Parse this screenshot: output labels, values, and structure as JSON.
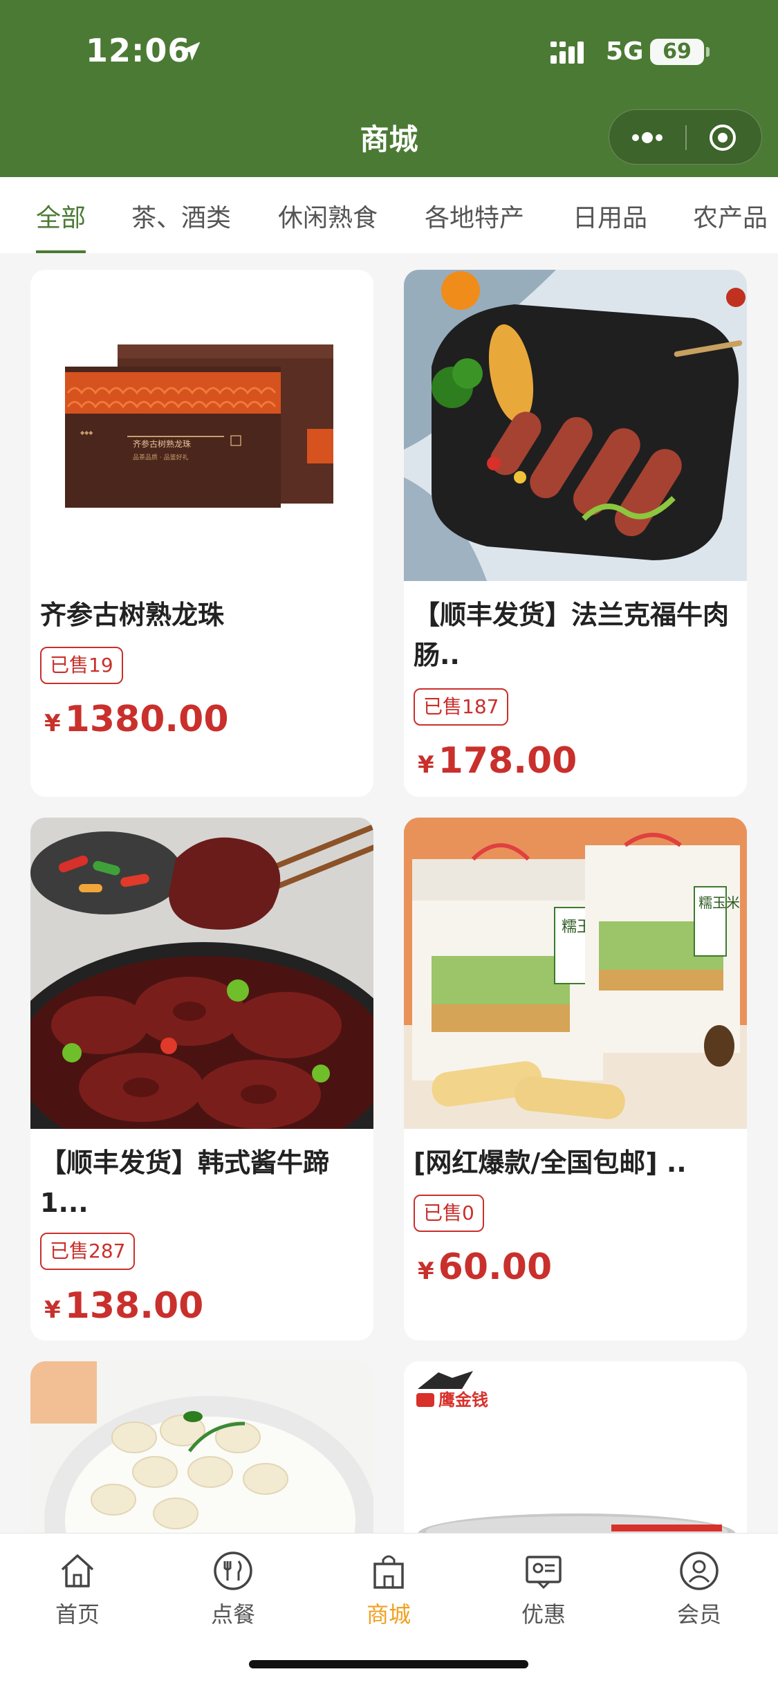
{
  "status_bar": {
    "time": "12:06",
    "network": "5G",
    "battery": "69"
  },
  "header": {
    "title": "商城",
    "more_icon": "more-dots-icon",
    "close_icon": "target-close-icon"
  },
  "tabs": [
    {
      "label": "全部",
      "active": true
    },
    {
      "label": "茶、酒类",
      "active": false
    },
    {
      "label": "休闲熟食",
      "active": false
    },
    {
      "label": "各地特产",
      "active": false
    },
    {
      "label": "日用品",
      "active": false
    },
    {
      "label": "农产品",
      "active": false
    }
  ],
  "products": [
    {
      "title": "齐参古树熟龙珠",
      "sold": "已售19",
      "currency": "¥",
      "price": "1380.00",
      "image_text": "齐参古树熟龙珠",
      "image_caption": "品茶品质 · 品鉴好礼"
    },
    {
      "title": "【顺丰发货】法兰克福牛肉肠..",
      "sold": "已售187",
      "currency": "¥",
      "price": "178.00"
    },
    {
      "title": "【顺丰发货】韩式酱牛蹄1...",
      "sold": "已售287",
      "currency": "¥",
      "price": "138.00"
    },
    {
      "title": "[网红爆款/全国包邮] ..",
      "sold": "已售0",
      "currency": "¥",
      "price": "60.00",
      "image_text": "糯玉米"
    },
    {
      "title": "",
      "sold": "",
      "currency": "",
      "price": ""
    },
    {
      "title": "",
      "sold": "",
      "currency": "",
      "price": "",
      "image_brand": "鹰金钱"
    }
  ],
  "tabbar": [
    {
      "label": "首页",
      "icon": "home-icon",
      "active": false
    },
    {
      "label": "点餐",
      "icon": "fork-knife-icon",
      "active": false
    },
    {
      "label": "商城",
      "icon": "shopping-bag-icon",
      "active": true
    },
    {
      "label": "优惠",
      "icon": "coupon-icon",
      "active": false
    },
    {
      "label": "会员",
      "icon": "member-icon",
      "active": false
    }
  ],
  "colors": {
    "brand": "#4b7a34",
    "price": "#c9302c",
    "tab_active": "#f0a020"
  }
}
